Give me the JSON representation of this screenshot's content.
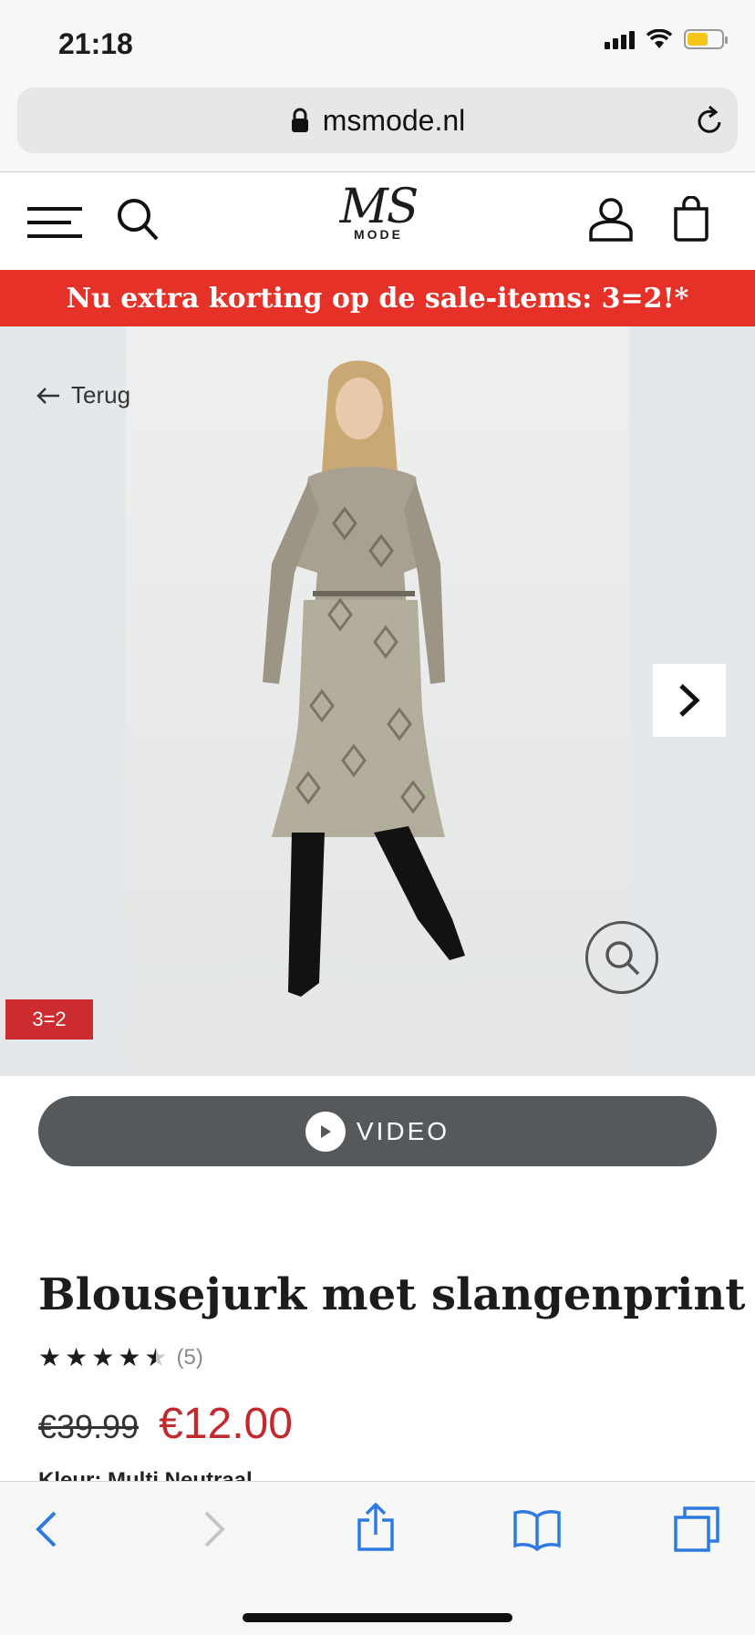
{
  "status_bar": {
    "time": "21:18"
  },
  "browser": {
    "url": "msmode.nl"
  },
  "header": {
    "logo_main": "MS",
    "logo_sub": "MODE"
  },
  "promo": {
    "text": "Nu extra korting op de sale-items: 3=2!*"
  },
  "gallery": {
    "back_label": "Terug",
    "badge": "3=2"
  },
  "video": {
    "label": "VIDEO"
  },
  "product": {
    "title": "Blousejurk met slangenprint",
    "rating": 4.5,
    "review_count": "(5)",
    "old_price": "€39.99",
    "new_price": "€12.00",
    "colour": "Kleur: Multi Neutraal"
  },
  "colors": {
    "promo_red": "#e53127",
    "price_red": "#c22a30",
    "badge_red": "#cc2b2f",
    "video_grey": "#56595c",
    "ios_blue": "#2f7ae0"
  }
}
